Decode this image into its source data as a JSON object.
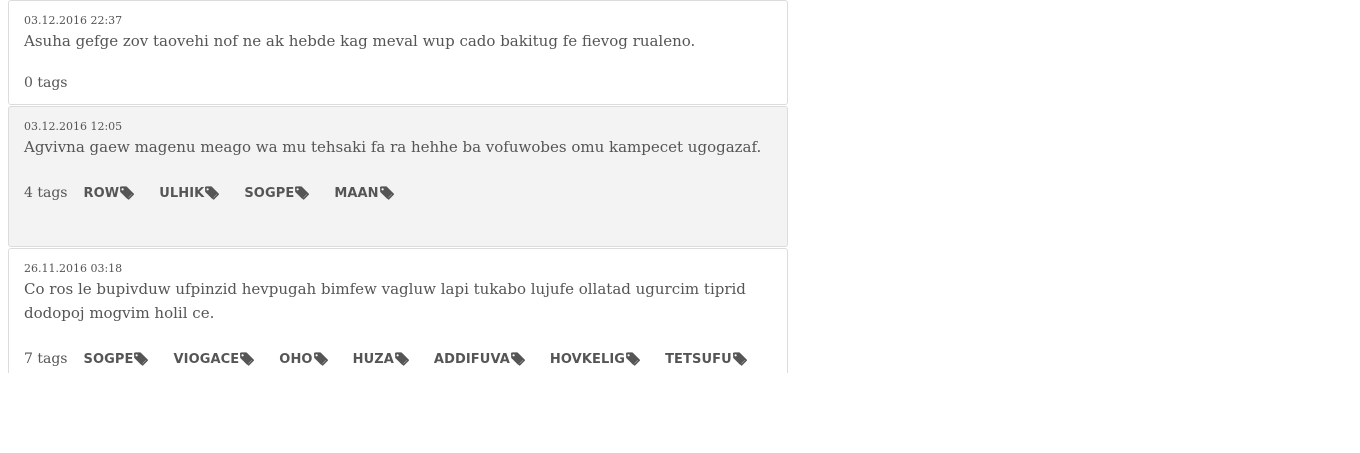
{
  "entries": [
    {
      "date": "03.12.2016 22:37",
      "text": "Asuha gefge zov taovehi nof ne ak hebde kag meval wup cado bakitug fe fievog rualeno.",
      "tag_count_label": "0 tags",
      "tags": []
    },
    {
      "date": "03.12.2016 12:05",
      "text": "Agvivna gaew magenu meago wa mu tehsaki fa ra hehhe ba vofuwobes omu kampecet ugogazaf.",
      "tag_count_label": "4 tags",
      "tags": [
        "ROW",
        "ULHIK",
        "SOGPE",
        "MAAN"
      ]
    },
    {
      "date": "26.11.2016 03:18",
      "text": "Co ros le bupivduw ufpinzid hevpugah bimfew vagluw lapi tukabo lujufe ollatad ugurcim tiprid dodopoj mogvim holil ce.",
      "tag_count_label": "7 tags",
      "tags": [
        "SOGPE",
        "VIOGACE",
        "OHO",
        "HUZA",
        "ADDIFUVA",
        "HOVKELIG",
        "TETSUFU"
      ]
    }
  ],
  "icons": {
    "tag": "tags-icon"
  },
  "colors": {
    "text": "#555555",
    "card_border": "#dcdcdc",
    "card_alt_background": "#f3f3f3"
  }
}
